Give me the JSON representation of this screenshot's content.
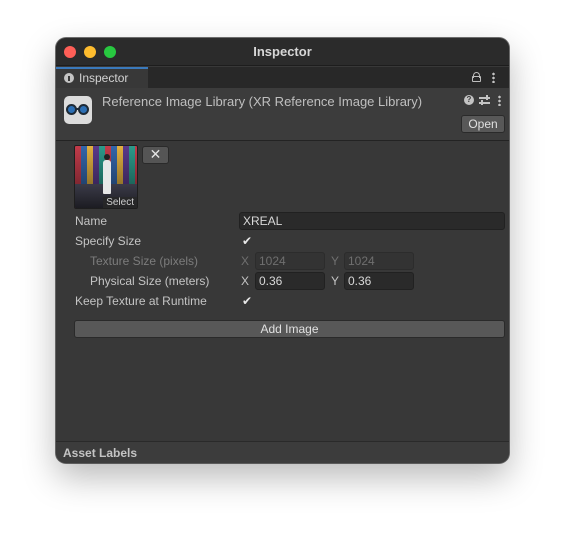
{
  "window": {
    "title": "Inspector",
    "traffic_lights": {
      "close": "#ff5f57",
      "minimize": "#febc2e",
      "maximize": "#28c840"
    }
  },
  "tab": {
    "label": "Inspector",
    "icon": "info-icon",
    "active_accent": "#3a79bb"
  },
  "header": {
    "icon": "xr-reference-image-library-icon",
    "title": "Reference Image Library (XR Reference Image Library)",
    "open_label": "Open"
  },
  "image_entry": {
    "thumbnail_label": "Select",
    "remove_label": "✕",
    "name_label": "Name",
    "name_value": "XREAL",
    "specify_size_label": "Specify Size",
    "specify_size_checked": true,
    "texture_size_label": "Texture Size (pixels)",
    "texture_size": {
      "x_label": "X",
      "x": "1024",
      "y_label": "Y",
      "y": "1024"
    },
    "physical_size_label": "Physical Size (meters)",
    "physical_size": {
      "x_label": "X",
      "x": "0.36",
      "y_label": "Y",
      "y": "0.36"
    },
    "keep_texture_label": "Keep Texture at Runtime",
    "keep_texture_checked": true,
    "checkmark": "✔"
  },
  "add_image_label": "Add Image",
  "footer": {
    "label": "Asset Labels"
  }
}
